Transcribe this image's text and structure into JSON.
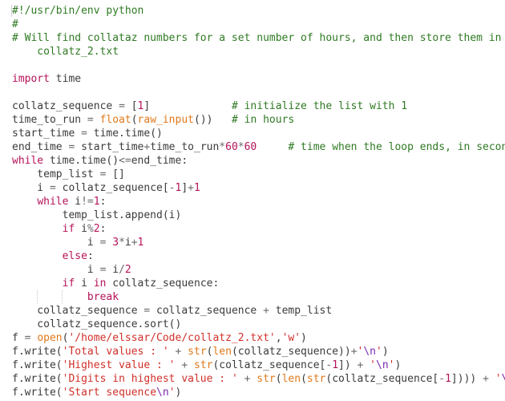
{
  "colors": {
    "comment": "#2f7a23",
    "keyword": "#b5135a",
    "builtin": "#e0791a",
    "string": "#d0302a",
    "number": "#b5135a",
    "escape": "#7a2bb0",
    "text": "#3b3b3b"
  },
  "lines": [
    [
      [
        "c",
        "#!/usr/bin/env python"
      ]
    ],
    [
      [
        "c",
        "#"
      ]
    ],
    [
      [
        "c",
        "# Will find collataz numbers for a set number of hours, and then store them in"
      ]
    ],
    [
      [
        "c",
        "    collatz_2.txt"
      ]
    ],
    [],
    [
      [
        "k",
        "import"
      ],
      [
        "t",
        " time"
      ]
    ],
    [],
    [
      [
        "t",
        "collatz_sequence "
      ],
      [
        "o",
        "="
      ],
      [
        "t",
        " ["
      ],
      [
        "n",
        "1"
      ],
      [
        "t",
        "]             "
      ],
      [
        "c",
        "# initialize the list with 1"
      ]
    ],
    [
      [
        "t",
        "time_to_run "
      ],
      [
        "o",
        "="
      ],
      [
        "t",
        " "
      ],
      [
        "b",
        "float"
      ],
      [
        "t",
        "("
      ],
      [
        "b",
        "raw_input"
      ],
      [
        "t",
        "())   "
      ],
      [
        "c",
        "# in hours"
      ]
    ],
    [
      [
        "t",
        "start_time "
      ],
      [
        "o",
        "="
      ],
      [
        "t",
        " time.time()"
      ]
    ],
    [
      [
        "t",
        "end_time "
      ],
      [
        "o",
        "="
      ],
      [
        "t",
        " start_time"
      ],
      [
        "o",
        "+"
      ],
      [
        "t",
        "time_to_run"
      ],
      [
        "o",
        "*"
      ],
      [
        "n",
        "60"
      ],
      [
        "o",
        "*"
      ],
      [
        "n",
        "60"
      ],
      [
        "t",
        "     "
      ],
      [
        "c",
        "# time when the loop ends, in seconds"
      ]
    ],
    [
      [
        "k",
        "while"
      ],
      [
        "t",
        " time.time()"
      ],
      [
        "o",
        "<="
      ],
      [
        "t",
        "end_time:"
      ]
    ],
    [
      [
        "t",
        "    temp_list "
      ],
      [
        "o",
        "="
      ],
      [
        "t",
        " []"
      ]
    ],
    [
      [
        "t",
        "    i "
      ],
      [
        "o",
        "="
      ],
      [
        "t",
        " collatz_sequence["
      ],
      [
        "o",
        "-"
      ],
      [
        "n",
        "1"
      ],
      [
        "t",
        "]"
      ],
      [
        "o",
        "+"
      ],
      [
        "n",
        "1"
      ]
    ],
    [
      [
        "t",
        "    "
      ],
      [
        "k",
        "while"
      ],
      [
        "t",
        " i"
      ],
      [
        "o",
        "!="
      ],
      [
        "n",
        "1"
      ],
      [
        "t",
        ":"
      ]
    ],
    [
      [
        "t",
        "        temp_list.append(i)"
      ]
    ],
    [
      [
        "t",
        "        "
      ],
      [
        "k",
        "if"
      ],
      [
        "t",
        " i"
      ],
      [
        "o",
        "%"
      ],
      [
        "n",
        "2"
      ],
      [
        "t",
        ":"
      ]
    ],
    [
      [
        "t",
        "            i "
      ],
      [
        "o",
        "="
      ],
      [
        "t",
        " "
      ],
      [
        "n",
        "3"
      ],
      [
        "o",
        "*"
      ],
      [
        "t",
        "i"
      ],
      [
        "o",
        "+"
      ],
      [
        "n",
        "1"
      ]
    ],
    [
      [
        "t",
        "        "
      ],
      [
        "k",
        "else"
      ],
      [
        "t",
        ":"
      ]
    ],
    [
      [
        "t",
        "            i "
      ],
      [
        "o",
        "="
      ],
      [
        "t",
        " i"
      ],
      [
        "o",
        "/"
      ],
      [
        "n",
        "2"
      ]
    ],
    [
      [
        "t",
        "        "
      ],
      [
        "k",
        "if"
      ],
      [
        "t",
        " i "
      ],
      [
        "k",
        "in"
      ],
      [
        "t",
        " collatz_sequence:"
      ]
    ],
    [
      [
        "t",
        "            "
      ],
      [
        "k",
        "break"
      ]
    ],
    [
      [
        "t",
        "    collatz_sequence "
      ],
      [
        "o",
        "="
      ],
      [
        "t",
        " collatz_sequence "
      ],
      [
        "o",
        "+"
      ],
      [
        "t",
        " temp_list"
      ]
    ],
    [
      [
        "t",
        "    collatz_sequence.sort()"
      ]
    ],
    [
      [
        "t",
        "f "
      ],
      [
        "o",
        "="
      ],
      [
        "t",
        " "
      ],
      [
        "b",
        "open"
      ],
      [
        "t",
        "("
      ],
      [
        "s",
        "'/home/elssar/Code/collatz_2.txt'"
      ],
      [
        "t",
        ","
      ],
      [
        "s",
        "'w'"
      ],
      [
        "t",
        ")"
      ]
    ],
    [
      [
        "t",
        "f.write("
      ],
      [
        "s",
        "'Total values : '"
      ],
      [
        "t",
        " "
      ],
      [
        "o",
        "+"
      ],
      [
        "t",
        " "
      ],
      [
        "b",
        "str"
      ],
      [
        "t",
        "("
      ],
      [
        "b",
        "len"
      ],
      [
        "t",
        "(collatz_sequence))"
      ],
      [
        "o",
        "+"
      ],
      [
        "s",
        "'"
      ],
      [
        "e",
        "\\n"
      ],
      [
        "s",
        "'"
      ],
      [
        "t",
        ")"
      ]
    ],
    [
      [
        "t",
        "f.write("
      ],
      [
        "s",
        "'Highest value : '"
      ],
      [
        "t",
        " "
      ],
      [
        "o",
        "+"
      ],
      [
        "t",
        " "
      ],
      [
        "b",
        "str"
      ],
      [
        "t",
        "(collatz_sequence["
      ],
      [
        "o",
        "-"
      ],
      [
        "n",
        "1"
      ],
      [
        "t",
        "]) "
      ],
      [
        "o",
        "+"
      ],
      [
        "t",
        " "
      ],
      [
        "s",
        "'"
      ],
      [
        "e",
        "\\n"
      ],
      [
        "s",
        "'"
      ],
      [
        "t",
        ")"
      ]
    ],
    [
      [
        "t",
        "f.write("
      ],
      [
        "s",
        "'Digits in highest value : '"
      ],
      [
        "t",
        " "
      ],
      [
        "o",
        "+"
      ],
      [
        "t",
        " "
      ],
      [
        "b",
        "str"
      ],
      [
        "t",
        "("
      ],
      [
        "b",
        "len"
      ],
      [
        "t",
        "("
      ],
      [
        "b",
        "str"
      ],
      [
        "t",
        "(collatz_sequence["
      ],
      [
        "o",
        "-"
      ],
      [
        "n",
        "1"
      ],
      [
        "t",
        "]))) "
      ],
      [
        "o",
        "+"
      ],
      [
        "t",
        " "
      ],
      [
        "s",
        "'"
      ],
      [
        "e",
        "\\n"
      ],
      [
        "s",
        "'"
      ],
      [
        "t",
        ")"
      ]
    ],
    [
      [
        "t",
        "f.write("
      ],
      [
        "s",
        "'Start sequence"
      ],
      [
        "e",
        "\\n"
      ],
      [
        "s",
        "'"
      ],
      [
        "t",
        ")"
      ]
    ]
  ]
}
